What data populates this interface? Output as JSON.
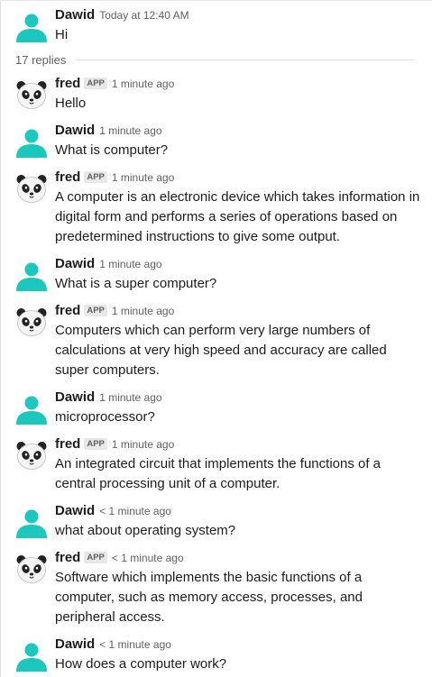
{
  "parent": {
    "author": "Dawid",
    "time": "Today at 12:40 AM",
    "text": "Hi"
  },
  "replies_label": "17 replies",
  "messages": [
    {
      "author": "fred",
      "badge": "APP",
      "time": "1 minute ago",
      "text": "Hello"
    },
    {
      "author": "Dawid",
      "time": "1 minute ago",
      "text": "What is computer?"
    },
    {
      "author": "fred",
      "badge": "APP",
      "time": "1 minute ago",
      "text": "A computer is an electronic device which takes information in digital form and performs a series of operations based on predetermined instructions to give some output."
    },
    {
      "author": "Dawid",
      "time": "1 minute ago",
      "text": "What is a super computer?"
    },
    {
      "author": "fred",
      "badge": "APP",
      "time": "1 minute ago",
      "text": "Computers which can perform very large numbers of calculations at very high speed and accuracy are called super computers."
    },
    {
      "author": "Dawid",
      "time": "1 minute ago",
      "text": "microprocessor?"
    },
    {
      "author": "fred",
      "badge": "APP",
      "time": "1 minute ago",
      "text": "An integrated circuit that implements the functions of a central processing unit of a computer."
    },
    {
      "author": "Dawid",
      "time": "< 1 minute ago",
      "text": "what about operating system?"
    },
    {
      "author": "fred",
      "badge": "APP",
      "time": "< 1 minute ago",
      "text": "Software which implements the basic functions of a computer, such as memory access, processes, and peripheral access."
    },
    {
      "author": "Dawid",
      "time": "< 1 minute ago",
      "text": "How does a computer work?"
    }
  ],
  "colors": {
    "user_avatar": "#1cc8bd",
    "text": "#1d1c1d",
    "meta": "#616061"
  },
  "icons": {
    "user_avatar": "person-avatar-icon",
    "bot_avatar": "panda-avatar-icon"
  }
}
